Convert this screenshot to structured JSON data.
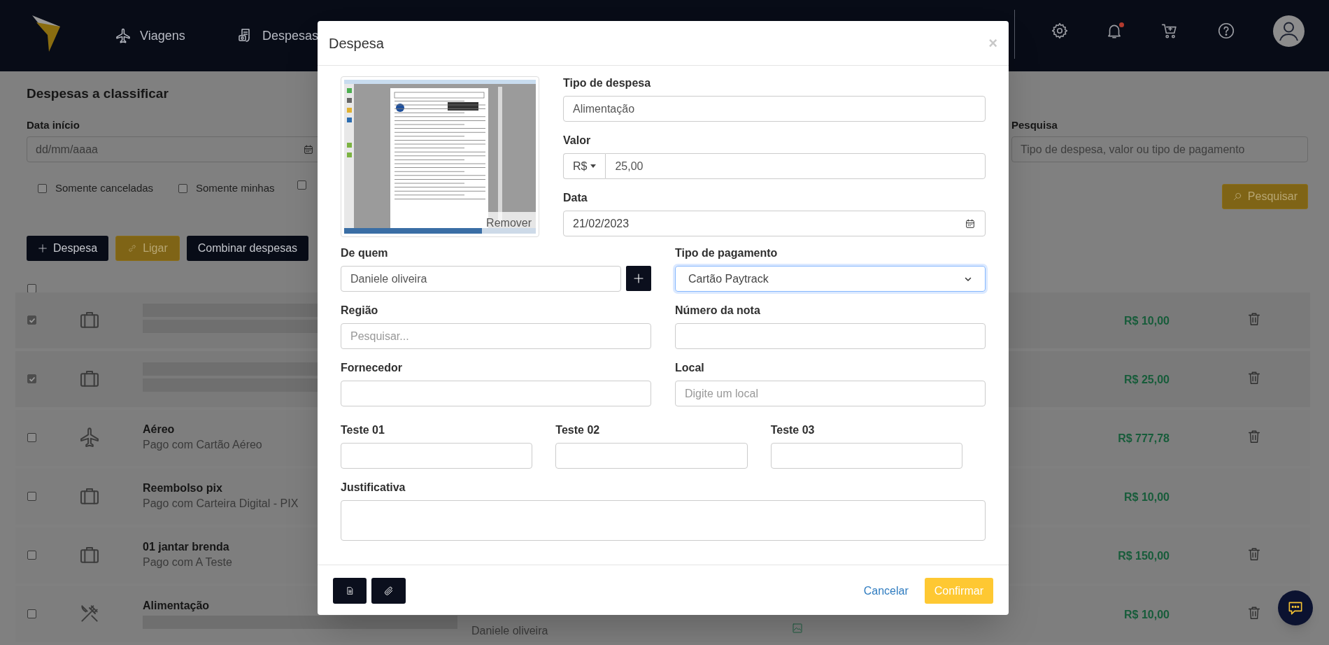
{
  "topbar": {
    "nav": [
      {
        "label": "Viagens",
        "kind": "trips"
      },
      {
        "label": "Despesas",
        "kind": "expenses"
      }
    ],
    "has_notification": true
  },
  "page": {
    "title": "Despesas a classificar",
    "date_label": "Data início",
    "date_placeholder": "dd/mm/aaaa",
    "search_label": "Pesquisa",
    "search_placeholder": "Tipo de despesa, valor ou tipo de pagamento",
    "filters": [
      {
        "label": "Somente canceladas",
        "checked": false
      },
      {
        "label": "Somente minhas",
        "checked": false
      },
      {
        "checked": false
      }
    ],
    "search_button": "Pesquisar",
    "actions": [
      {
        "label": "Despesa",
        "kind": "add"
      },
      {
        "label": "Ligar",
        "kind": "link"
      },
      {
        "label": "Combinar despesas",
        "kind": "plain"
      }
    ],
    "select_all": {
      "checked": false
    },
    "rows": [
      {
        "checked": true,
        "kind": "general",
        "amount": "R$ 10,00",
        "deletable": true
      },
      {
        "checked": true,
        "kind": "general",
        "amount": "R$ 25,00",
        "deletable": true
      },
      {
        "checked": false,
        "kind": "flight",
        "title": "Aéreo",
        "subtitle": "Pago com Cartão Aéreo",
        "amount": "R$ 777,78",
        "deletable": true
      },
      {
        "checked": false,
        "kind": "general",
        "title": "Reembolso pix",
        "subtitle": "Pago com Carteira Digital - PIX",
        "amount": "R$ 10,00",
        "deletable": false
      },
      {
        "checked": false,
        "kind": "general",
        "title": "01 jantar brenda",
        "subtitle": "Pago com A Teste",
        "amount": "R$ 150,00",
        "deletable": true
      },
      {
        "checked": false,
        "kind": "meal",
        "title": "Alimentação",
        "person": "Daniele oliveira",
        "has_receipt": true,
        "amount": "R$ 10,00",
        "deletable": true
      }
    ]
  },
  "modal": {
    "title": "Despesa",
    "close": "×",
    "remove_label": "Remover",
    "expense_type": {
      "label": "Tipo de despesa",
      "value": "Alimentação"
    },
    "amount": {
      "label": "Valor",
      "currency": "R$",
      "value": "25,00"
    },
    "date": {
      "label": "Data",
      "value": "21/02/2023"
    },
    "from_whom": {
      "label": "De quem",
      "value": "Daniele oliveira"
    },
    "payment_type": {
      "label": "Tipo de pagamento",
      "value": "Cartão Paytrack",
      "focused": true
    },
    "fields": [
      {
        "label": "Região",
        "placeholder": "Pesquisar..."
      },
      {
        "label": "Número da nota"
      },
      {
        "label": "Fornecedor"
      },
      {
        "label": "Local",
        "placeholder": "Digite um local"
      }
    ],
    "custom_fields": [
      {
        "label": "Teste 01"
      },
      {
        "label": "Teste 02"
      },
      {
        "label": "Teste 03"
      }
    ],
    "justification": {
      "label": "Justificativa"
    },
    "cancel": "Cancelar",
    "confirm": "Confirmar"
  }
}
